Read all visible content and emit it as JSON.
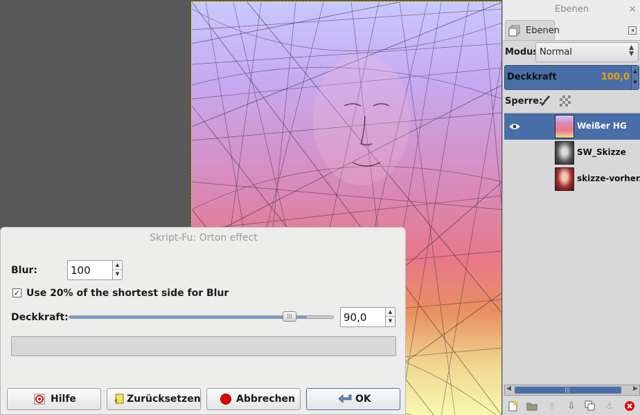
{
  "canvas": {},
  "dock": {
    "title": "Ebenen",
    "tab_label": "Ebenen",
    "mode_label": "Modus:",
    "mode_value": "Normal",
    "opacity_label": "Deckkraft",
    "opacity_value": "100,0",
    "lock_label": "Sperre:",
    "layers": [
      {
        "name": "Weißer HG",
        "visible": true,
        "selected": true
      },
      {
        "name": "SW_Skizze",
        "visible": false,
        "selected": false
      },
      {
        "name": "skizze-vorher.jpg",
        "visible": false,
        "selected": false
      }
    ]
  },
  "dialog": {
    "title": "Skript-Fu: Orton effect",
    "blur_label": "Blur:",
    "blur_value": "100",
    "use_checkbox_checked": true,
    "use_label": "Use 20% of the shortest side for Blur",
    "opacity_label": "Deckkraft:",
    "opacity_value": "90,0",
    "opacity_fraction": 0.9,
    "buttons": {
      "help": "Hilfe",
      "reset": "Zurücksetzen",
      "cancel": "Abbrechen",
      "ok": "OK"
    }
  },
  "colors": {
    "selection": "#4a6ea8",
    "opacity_value": "#f0a000",
    "cancel_icon": "#e00000"
  },
  "icons": [
    "layers-icon",
    "eye-icon",
    "paintbrush-icon",
    "alpha-lock-icon",
    "new-layer-icon",
    "open-folder-icon",
    "raise-layer-icon",
    "lower-layer-icon",
    "duplicate-layer-icon",
    "anchor-icon",
    "delete-layer-icon",
    "help-icon",
    "reset-icon",
    "stop-icon",
    "ok-arrow-icon"
  ]
}
